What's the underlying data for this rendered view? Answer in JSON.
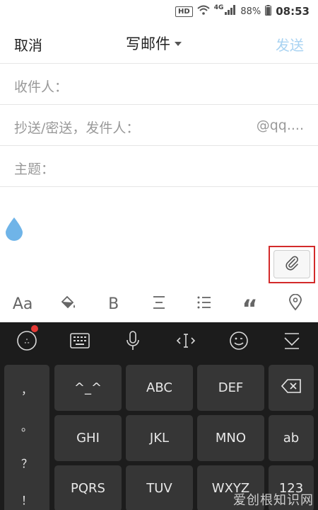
{
  "status_bar": {
    "hd": "HD",
    "network": "4G",
    "battery": "88%",
    "time": "08:53"
  },
  "header": {
    "cancel": "取消",
    "title": "写邮件",
    "send": "发送"
  },
  "form": {
    "to_label": "收件人：",
    "cc_label": "抄送/密送，发件人：",
    "cc_value": "@qq....",
    "subject_label": "主题："
  },
  "toolbar": {
    "font_label": "Aa",
    "bold_label": "B",
    "quote_label": "“"
  },
  "keyboard": {
    "comma": "，",
    "period": "。",
    "question": "？",
    "exclaim": "！",
    "keys": {
      "k1": "^_^",
      "k2": "ABC",
      "k3": "DEF",
      "k4": "GHI",
      "k5": "JKL",
      "k6": "MNO",
      "k7": "ab",
      "k8": "PQRS",
      "k9": "TUV",
      "k10": "WXYZ",
      "k11": "123"
    }
  },
  "watermark": "爱创根知识网",
  "colors": {
    "send_disabled": "#a9d3f2",
    "accent_blue": "#5aa9e6",
    "highlight_red": "#d32a2a",
    "keyboard_bg": "#1c1c1c",
    "key_bg": "#363636"
  }
}
